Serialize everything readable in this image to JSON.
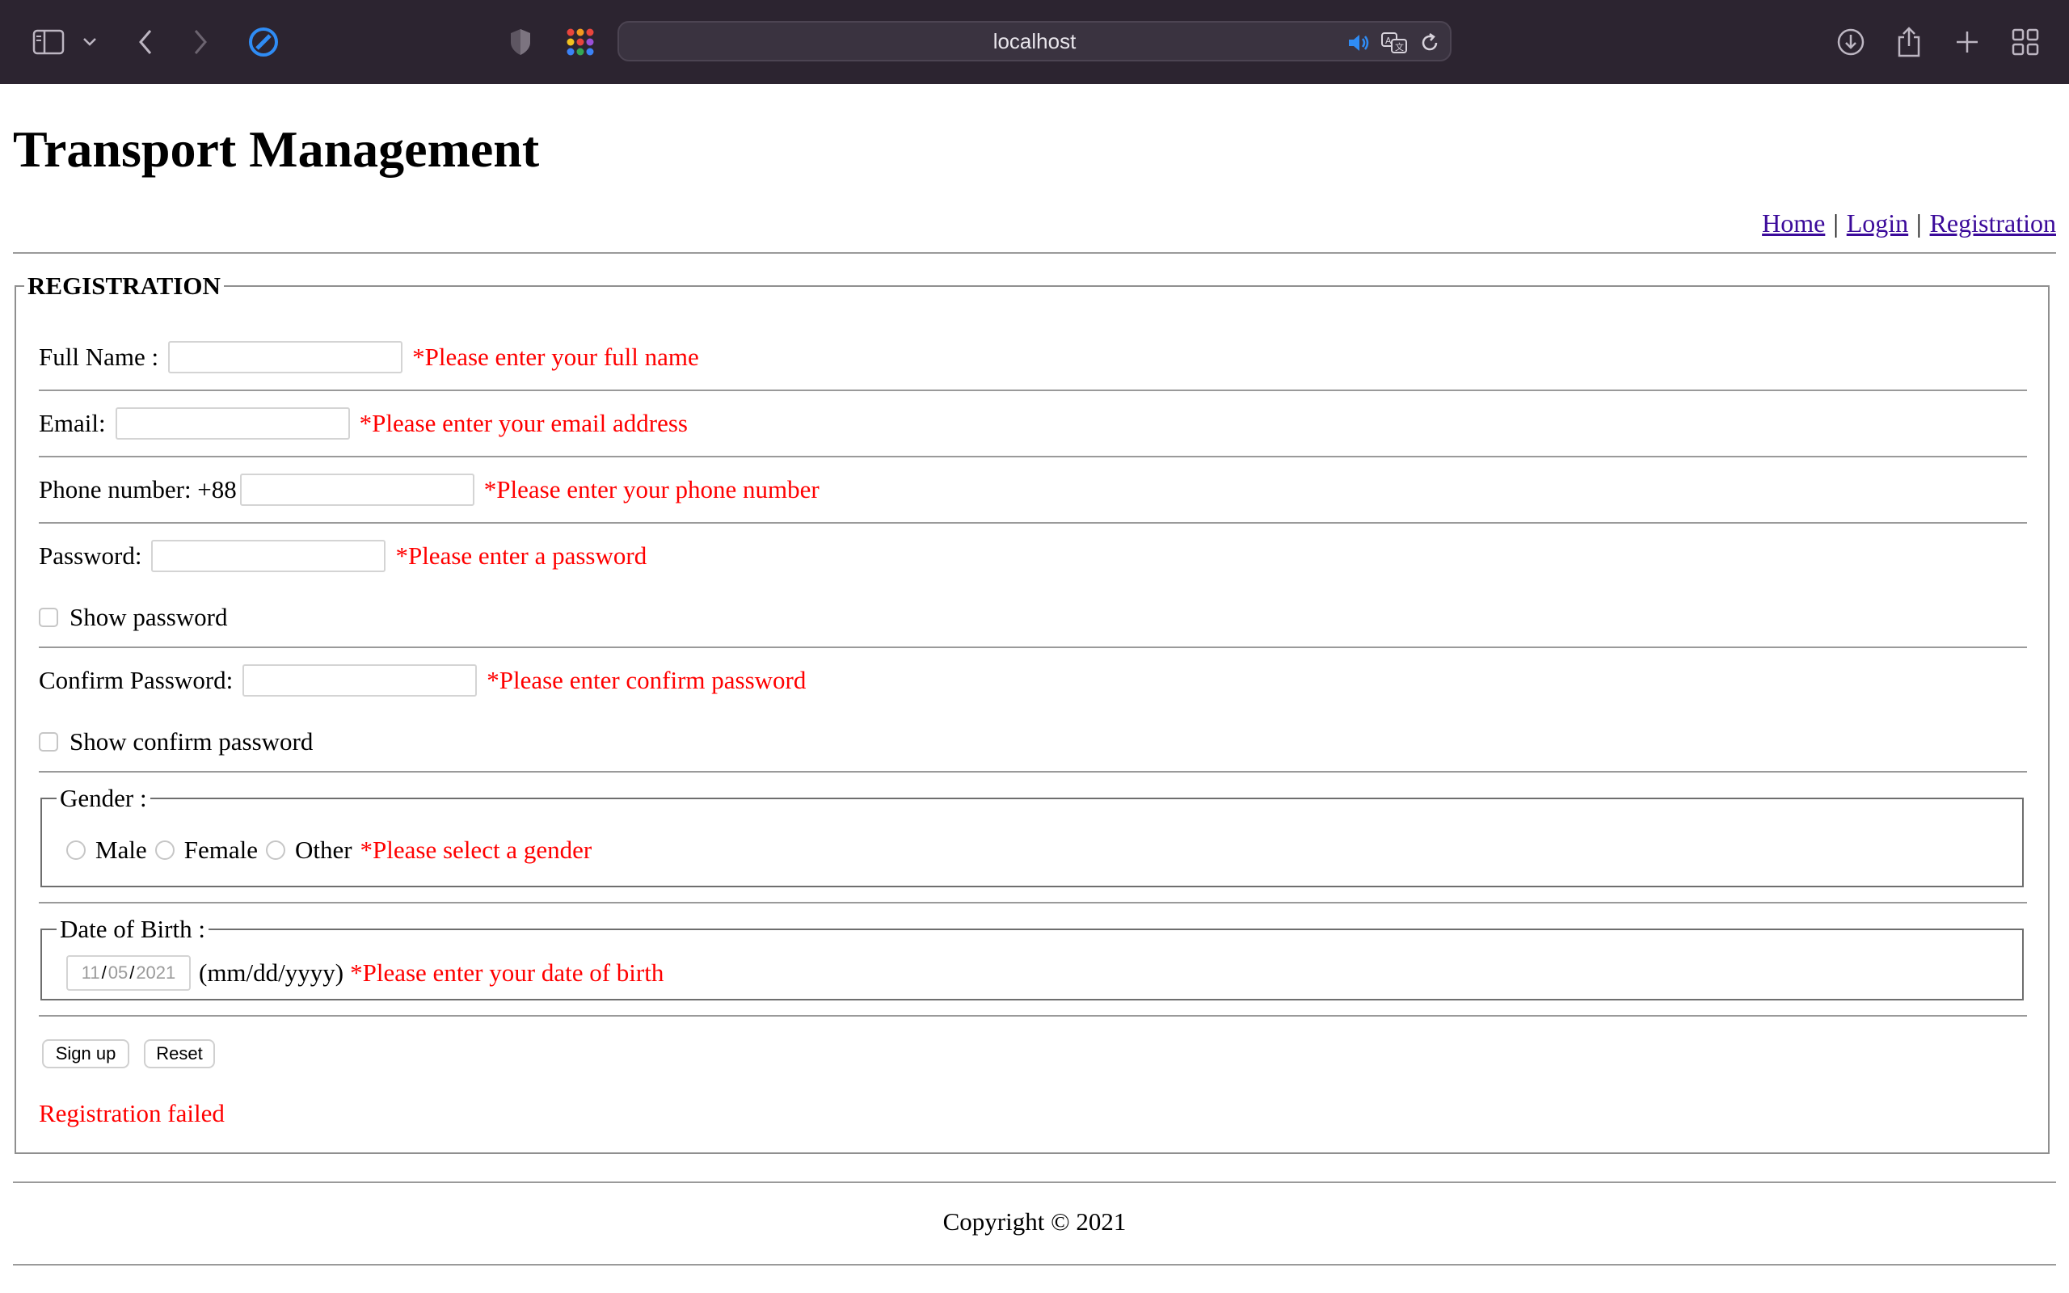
{
  "browser": {
    "url": "localhost",
    "icons": [
      "sidebar-icon",
      "chevron-down-icon",
      "back-icon",
      "forward-icon",
      "compass-icon",
      "shield-icon",
      "apps-grid-icon",
      "speaker-icon",
      "translate-icon",
      "reload-icon",
      "download-icon",
      "share-icon",
      "plus-icon",
      "tab-overview-icon"
    ]
  },
  "site": {
    "title": "Transport Management",
    "nav": {
      "home": "Home",
      "login": "Login",
      "registration": "Registration",
      "separator": "|"
    }
  },
  "form": {
    "legend": "REGISTRATION",
    "full_name": {
      "label": "Full Name :",
      "value": "",
      "error": "*Please enter your full name"
    },
    "email": {
      "label": "Email:",
      "value": "",
      "error": "*Please enter your email address"
    },
    "phone": {
      "label": "Phone number: +88",
      "value": "",
      "error": "*Please enter your phone number"
    },
    "password": {
      "label": "Password:",
      "value": "",
      "error": "*Please enter a password"
    },
    "show_password": "Show password",
    "confirm_password": {
      "label": "Confirm Password:",
      "value": "",
      "error": "*Please enter confirm password"
    },
    "show_confirm_password": "Show confirm password",
    "gender": {
      "legend": "Gender :",
      "options": [
        "Male",
        "Female",
        "Other"
      ],
      "error": "*Please select a gender"
    },
    "dob": {
      "legend": "Date of Birth :",
      "month": "11",
      "day": "05",
      "year": "2021",
      "hint": "(mm/dd/yyyy)",
      "error": "*Please enter your date of birth"
    },
    "signup_label": "Sign up",
    "reset_label": "Reset",
    "status": "Registration failed"
  },
  "footer": {
    "text": "Copyright © 2021"
  },
  "colors": {
    "error": "#ff0000",
    "link": "#3b0a9a",
    "toolbar": "#2c2430"
  }
}
